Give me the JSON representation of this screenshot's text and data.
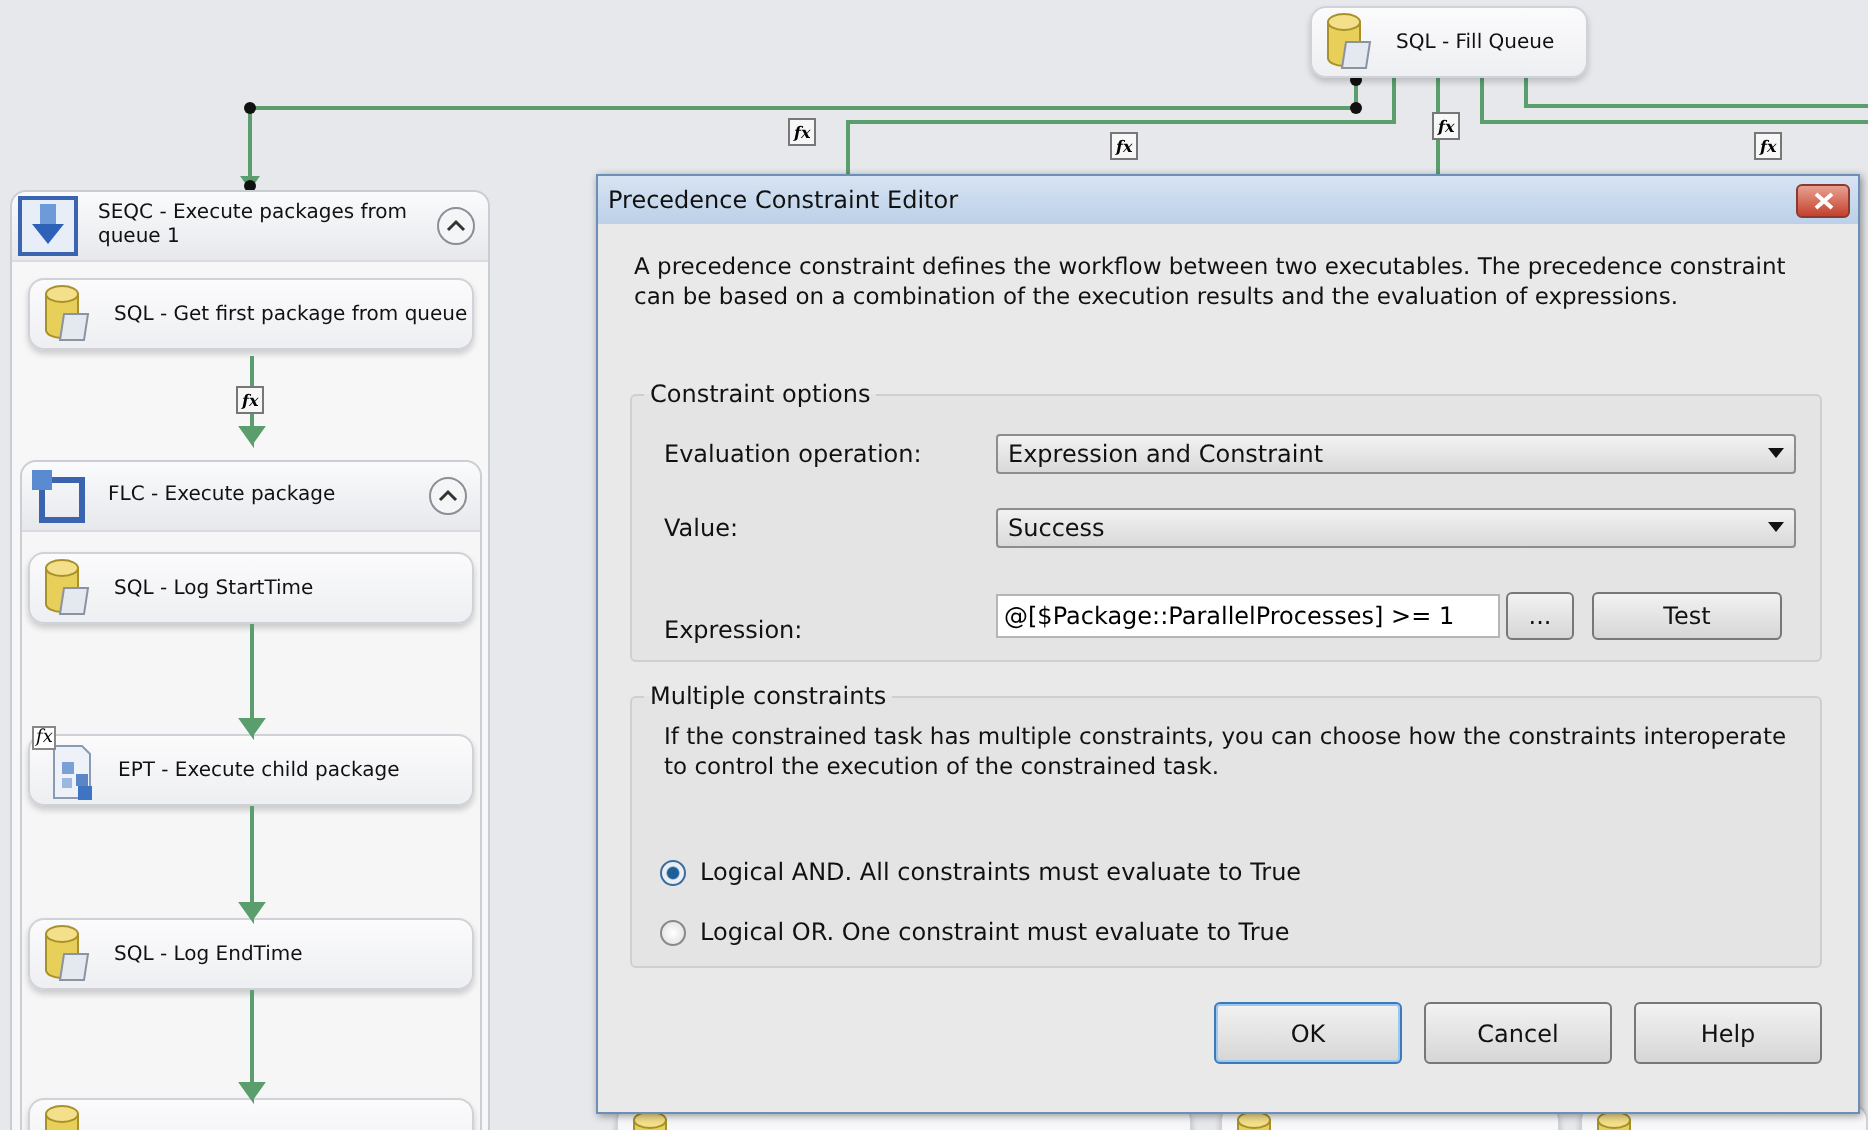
{
  "canvas": {
    "top_task": {
      "name": "SQL - Fill Queue",
      "kind": "sql"
    },
    "expression_marks": [
      {
        "label": "fx"
      },
      {
        "label": "fx"
      },
      {
        "label": "fx"
      },
      {
        "label": "fx"
      }
    ],
    "sequence_container": {
      "title": "SEQC - Execute packages from queue 1",
      "kind": "sequence",
      "expanded": true,
      "tasks": [
        {
          "name": "SQL - Get first package from queue",
          "kind": "sql"
        }
      ],
      "inner_mark": {
        "label": "fx"
      },
      "loop_container": {
        "title": "FLC - Execute package",
        "kind": "loop",
        "expanded": true,
        "tasks": [
          {
            "name": "SQL - Log StartTime",
            "kind": "sql"
          },
          {
            "name": "EPT - Execute child package",
            "kind": "package",
            "badge": "fx"
          },
          {
            "name": "SQL - Log EndTime",
            "kind": "sql"
          },
          {
            "kind": "sql"
          }
        ]
      }
    },
    "lower_tasks": [
      {
        "kind": "sql"
      },
      {
        "kind": "sql"
      },
      {
        "kind": "sql"
      }
    ]
  },
  "dialog": {
    "title": "Precedence Constraint Editor",
    "description": "A precedence constraint defines the workflow between two executables. The precedence constraint can be based on a combination of the execution results and the evaluation of expressions.",
    "constraint_options": {
      "legend": "Constraint options",
      "fields": [
        {
          "label": "Evaluation operation:",
          "kind": "dropdown",
          "value": "Expression and Constraint"
        },
        {
          "label": "Value:",
          "kind": "dropdown",
          "value": "Success"
        },
        {
          "label": "Expression:",
          "kind": "text",
          "value": "@[$Package::ParallelProcesses] >= 1",
          "buttons": [
            "...",
            "Test"
          ]
        }
      ]
    },
    "multiple_constraints": {
      "legend": "Multiple constraints",
      "description": "If the constrained task has multiple constraints, you can choose how the constraints interoperate to control the execution of the constrained task.",
      "options": [
        {
          "label": "Logical AND. All constraints must evaluate to True",
          "selected": true
        },
        {
          "label": "Logical OR. One constraint must evaluate to True",
          "selected": false
        }
      ]
    },
    "buttons": [
      {
        "label": "OK",
        "default": true
      },
      {
        "label": "Cancel",
        "default": false
      },
      {
        "label": "Help",
        "default": false
      }
    ]
  }
}
